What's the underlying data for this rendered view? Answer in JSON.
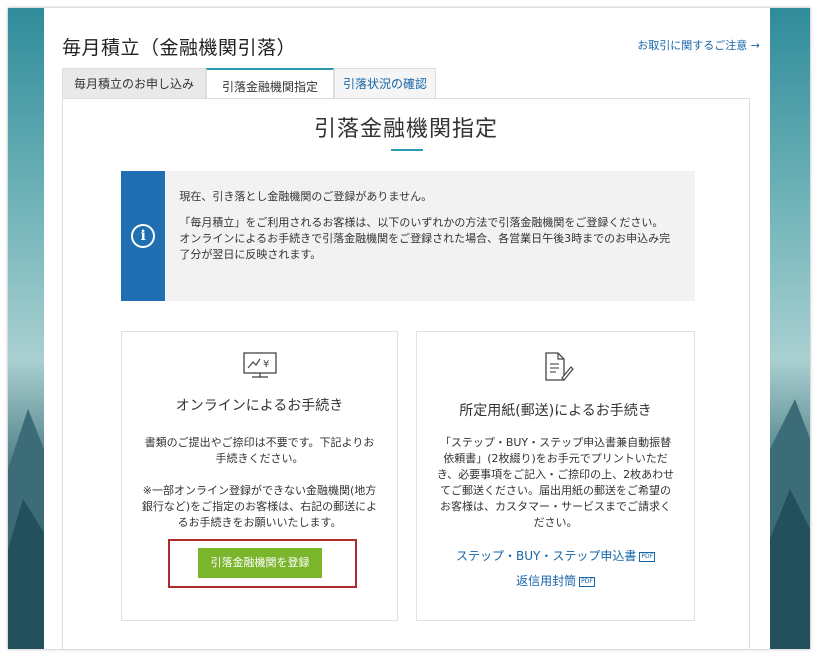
{
  "page": {
    "title": "毎月積立（金融機関引落）",
    "notice_link": "お取引に関するご注意 →"
  },
  "tabs": [
    {
      "label": "毎月積立のお申し込み"
    },
    {
      "label": "引落金融機関指定"
    },
    {
      "label": "引落状況の確認"
    }
  ],
  "section_title": "引落金融機関指定",
  "info": {
    "icon": "info-icon",
    "line1": "現在、引き落とし金融機関のご登録がありません。",
    "line2": "「毎月積立」をご利用されるお客様は、以下のいずれかの方法で引落金融機関をご登録ください。",
    "line3": "オンラインによるお手続きで引落金融機関をご登録された場合、各営業日午後3時までのお申込み完了分が翌日に反映されます。"
  },
  "online_card": {
    "icon": "monitor-yen-icon",
    "title": "オンラインによるお手続き",
    "desc1": "書類のご提出やご捺印は不要です。下記よりお手続きください。",
    "desc2": "※一部オンライン登録ができない金融機関(地方銀行など)をご指定のお客様は、右記の郵送によるお手続きをお願いいたします。",
    "button": "引落金融機関を登録"
  },
  "paper_card": {
    "icon": "document-pen-icon",
    "title": "所定用紙(郵送)によるお手続き",
    "desc": "「ステップ・BUY・ステップ申込書兼自動振替依頼書」(2枚綴り)をお手元でプリントいただき、必要事項をご記入・ご捺印の上、2枚あわせてご郵送ください。届出用紙の郵送をご希望のお客様は、カスタマー・サービスまでご請求ください。",
    "link1": "ステップ・BUY・ステップ申込書",
    "link2": "返信用封筒",
    "pdf_label": "PDF"
  },
  "colors": {
    "accent": "#2b9ab2",
    "info_bar": "#1f6fb2",
    "link": "#1565a8",
    "button": "#7ab52b",
    "highlight": "#b02a2a"
  }
}
